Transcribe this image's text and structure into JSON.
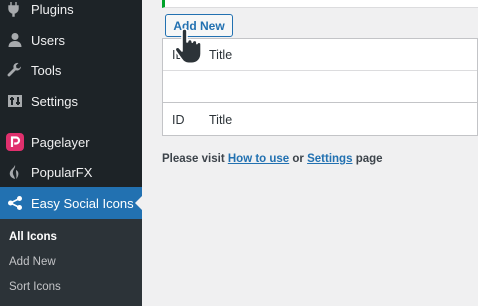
{
  "sidebar": {
    "items": [
      {
        "label": "Plugins",
        "icon": "plugin-icon"
      },
      {
        "label": "Users",
        "icon": "users-icon"
      },
      {
        "label": "Tools",
        "icon": "wrench-icon"
      },
      {
        "label": "Settings",
        "icon": "settings-icon"
      },
      {
        "label": "Pagelayer",
        "icon": "pagelayer-icon"
      },
      {
        "label": "PopularFX",
        "icon": "popularfx-icon"
      },
      {
        "label": "Easy Social Icons",
        "icon": "share-icon"
      }
    ],
    "submenu": [
      "All Icons",
      "Add New",
      "Sort Icons"
    ]
  },
  "main": {
    "add_new_label": "Add New",
    "table": {
      "header": {
        "id": "ID",
        "title": "Title"
      },
      "footer": {
        "id": "ID",
        "title": "Title"
      }
    },
    "info": {
      "prefix": "Please visit",
      "link1": "How to use",
      "middle": "or",
      "link2": "Settings",
      "suffix": "page"
    }
  },
  "colors": {
    "sidebar_bg": "#1d2327",
    "submenu_bg": "#2c3338",
    "accent": "#2271b1",
    "pagelayer": "#e0306d",
    "notice_border": "#00a32a"
  }
}
